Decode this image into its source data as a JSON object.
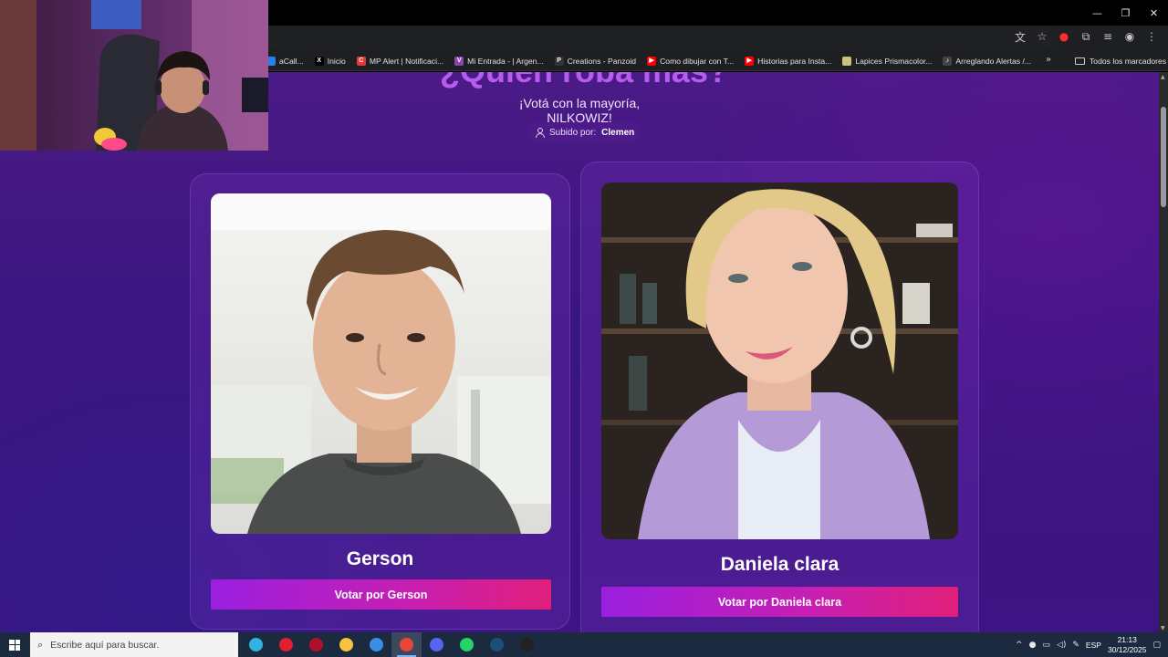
{
  "window": {
    "controls": [
      "—",
      "❐",
      "✕"
    ]
  },
  "bookmarks": {
    "items": [
      {
        "label": "aCall...",
        "color": "#2b7de9",
        "glyph": ""
      },
      {
        "label": "Inicio",
        "color": "#000000",
        "glyph": "X"
      },
      {
        "label": "MP Alert | Notificaci...",
        "color": "#e53935",
        "glyph": "C"
      },
      {
        "label": "Mi Entrada - | Argen...",
        "color": "#8e44ad",
        "glyph": "V"
      },
      {
        "label": "Creations - Panzoid",
        "color": "#333333",
        "glyph": "P"
      },
      {
        "label": "Como dibujar con T...",
        "color": "#ff0000",
        "glyph": "▶"
      },
      {
        "label": "Historias para Insta...",
        "color": "#ff0000",
        "glyph": "▶"
      },
      {
        "label": "Lapices Prismacolor...",
        "color": "#c9c27a",
        "glyph": ""
      },
      {
        "label": "Arreglando Alertas /...",
        "color": "#444444",
        "glyph": "♪"
      }
    ],
    "more": "»",
    "all_bookmarks": "Todos los marcadores"
  },
  "page": {
    "heading": "¿Quién roba más?",
    "subtitle": "¡Votá con la mayoría, NILKOWIZ!",
    "uploaded_by_label": "Subido por:",
    "uploaded_by_name": "Clemen"
  },
  "candidates": [
    {
      "name": "Gerson",
      "vote_label": "Votar por Gerson"
    },
    {
      "name": "Daniela clara",
      "vote_label": "Votar por Daniela clara"
    }
  ],
  "taskbar": {
    "search_placeholder": "Escribe aquí para buscar.",
    "apps": [
      {
        "name": "edge",
        "color": "#2fb3e0",
        "active": false
      },
      {
        "name": "opera-gx",
        "color": "#e01f2f",
        "active": false
      },
      {
        "name": "opera",
        "color": "#b0102a",
        "active": false
      },
      {
        "name": "file-explorer",
        "color": "#f5c242",
        "active": false
      },
      {
        "name": "microsoft-store",
        "color": "#3a8ee6",
        "active": false
      },
      {
        "name": "chrome",
        "color": "#e8453c",
        "active": true
      },
      {
        "name": "discord",
        "color": "#5865f2",
        "active": false
      },
      {
        "name": "whatsapp",
        "color": "#25d366",
        "active": false
      },
      {
        "name": "steam",
        "color": "#1b4f7a",
        "active": false
      },
      {
        "name": "obs",
        "color": "#222222",
        "active": false
      }
    ],
    "language": "ESP",
    "time": "21:13",
    "date": "30/12/2025"
  }
}
